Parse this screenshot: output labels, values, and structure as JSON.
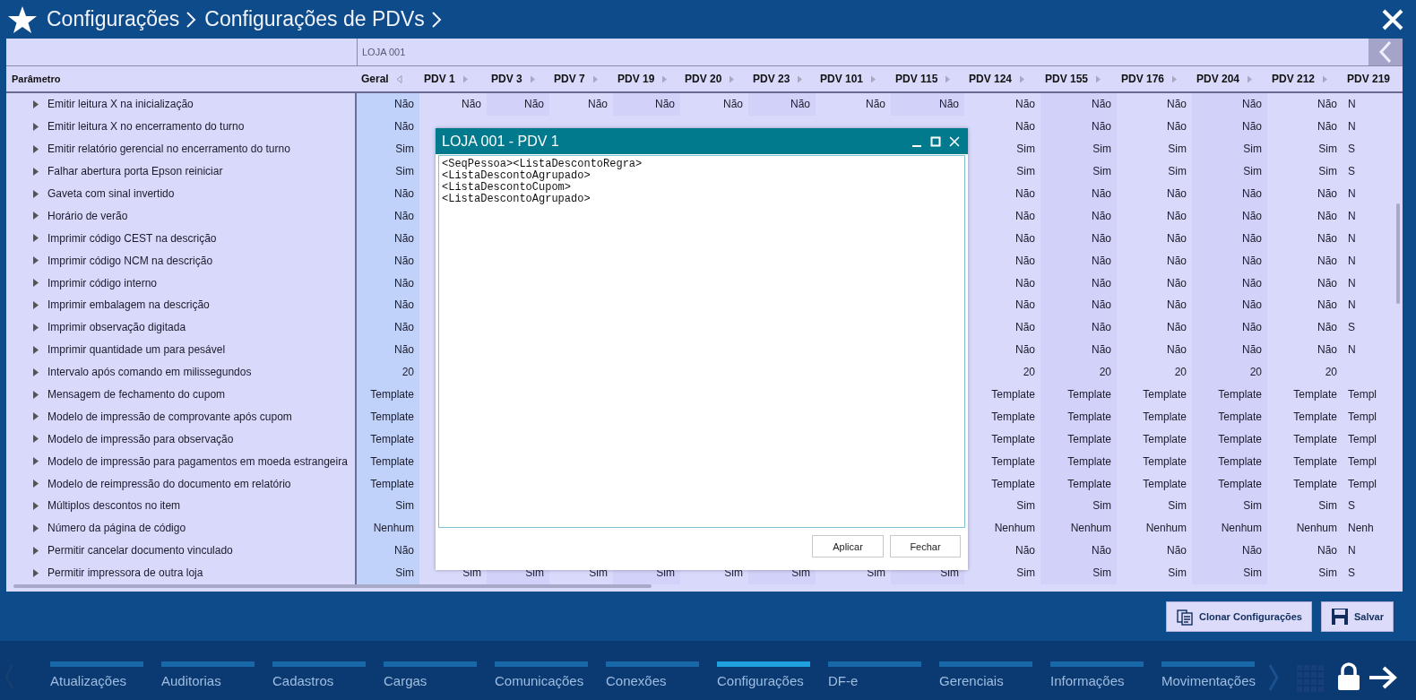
{
  "header": {
    "breadcrumbs": [
      "Configurações",
      "Configurações de PDVs"
    ]
  },
  "table": {
    "group_header": "LOJA 001",
    "parameter_header": "Parâmetro",
    "columns": [
      {
        "label": "Geral",
        "kind": "general"
      },
      {
        "label": "PDV 1",
        "kind": "pdv"
      },
      {
        "label": "PDV 3",
        "kind": "pdv"
      },
      {
        "label": "PDV 7",
        "kind": "pdv"
      },
      {
        "label": "PDV 19",
        "kind": "pdv"
      },
      {
        "label": "PDV 20",
        "kind": "pdv"
      },
      {
        "label": "PDV 23",
        "kind": "pdv"
      },
      {
        "label": "PDV 101",
        "kind": "pdv"
      },
      {
        "label": "PDV 115",
        "kind": "pdv"
      },
      {
        "label": "PDV 124",
        "kind": "pdv"
      },
      {
        "label": "PDV 155",
        "kind": "pdv"
      },
      {
        "label": "PDV 176",
        "kind": "pdv"
      },
      {
        "label": "PDV 204",
        "kind": "pdv"
      },
      {
        "label": "PDV 212",
        "kind": "pdv"
      },
      {
        "label": "PDV 219",
        "kind": "pdv"
      }
    ],
    "rows": [
      {
        "parameter": "Emitir leitura X na inicialização",
        "cells": [
          "Não",
          "Não",
          "Não",
          "Não",
          "Não",
          "Não",
          "Não",
          "Não",
          "Não",
          "Não",
          "Não",
          "Não",
          "Não",
          "Não",
          "N"
        ]
      },
      {
        "parameter": "Emitir leitura X no encerramento do turno",
        "cells": [
          "Não",
          null,
          null,
          null,
          null,
          null,
          null,
          null,
          null,
          "Não",
          "Não",
          "Não",
          "Não",
          "Não",
          "N"
        ]
      },
      {
        "parameter": "Emitir relatório gerencial no encerramento do turno",
        "cells": [
          "Sim",
          null,
          null,
          null,
          null,
          null,
          null,
          null,
          null,
          "Sim",
          "Sim",
          "Sim",
          "Sim",
          "Sim",
          "S"
        ]
      },
      {
        "parameter": "Falhar abertura porta Epson reiniciar",
        "cells": [
          "Sim",
          null,
          null,
          null,
          null,
          null,
          null,
          null,
          null,
          "Sim",
          "Sim",
          "Sim",
          "Sim",
          "Sim",
          "S"
        ]
      },
      {
        "parameter": "Gaveta com sinal invertido",
        "cells": [
          "Não",
          null,
          null,
          null,
          null,
          null,
          null,
          null,
          null,
          "Não",
          "Não",
          "Não",
          "Não",
          "Não",
          "N"
        ]
      },
      {
        "parameter": "Horário de verão",
        "cells": [
          "Não",
          null,
          null,
          null,
          null,
          null,
          null,
          null,
          null,
          "Não",
          "Não",
          "Não",
          "Não",
          "Não",
          "N"
        ]
      },
      {
        "parameter": "Imprimir código CEST na descrição",
        "cells": [
          "Não",
          null,
          null,
          null,
          null,
          null,
          null,
          null,
          null,
          "Não",
          "Não",
          "Não",
          "Não",
          "Não",
          "N"
        ]
      },
      {
        "parameter": "Imprimir código NCM na descrição",
        "cells": [
          "Não",
          null,
          null,
          null,
          null,
          null,
          null,
          null,
          null,
          "Não",
          "Não",
          "Não",
          "Não",
          "Não",
          "N"
        ]
      },
      {
        "parameter": "Imprimir código interno",
        "cells": [
          "Não",
          null,
          null,
          null,
          null,
          null,
          null,
          null,
          null,
          "Não",
          "Não",
          "Não",
          "Não",
          "Não",
          "N"
        ]
      },
      {
        "parameter": "Imprimir embalagem na descrição",
        "cells": [
          "Não",
          null,
          null,
          null,
          null,
          null,
          null,
          null,
          null,
          "Não",
          "Não",
          "Não",
          "Não",
          "Não",
          "N"
        ]
      },
      {
        "parameter": "Imprimir observação digitada",
        "cells": [
          "Não",
          null,
          null,
          null,
          null,
          null,
          null,
          null,
          null,
          "Não",
          "Não",
          "Não",
          "Não",
          "Não",
          "S"
        ]
      },
      {
        "parameter": "Imprimir quantidade um para pesável",
        "cells": [
          "Não",
          null,
          null,
          null,
          null,
          null,
          null,
          null,
          null,
          "Não",
          "Não",
          "Não",
          "Não",
          "Não",
          "N"
        ]
      },
      {
        "parameter": "Intervalo após comando em milissegundos",
        "cells": [
          "20",
          null,
          null,
          null,
          null,
          null,
          null,
          null,
          null,
          "20",
          "20",
          "20",
          "20",
          "20",
          null
        ]
      },
      {
        "parameter": "Mensagem de fechamento do cupom",
        "cells": [
          "Template",
          null,
          null,
          null,
          null,
          null,
          null,
          null,
          null,
          "Template",
          "Template",
          "Template",
          "Template",
          "Template",
          "Templ"
        ]
      },
      {
        "parameter": "Modelo de impressão de comprovante após cupom",
        "cells": [
          "Template",
          null,
          null,
          null,
          null,
          null,
          null,
          null,
          null,
          "Template",
          "Template",
          "Template",
          "Template",
          "Template",
          "Templ"
        ]
      },
      {
        "parameter": "Modelo de impressão para observação",
        "cells": [
          "Template",
          null,
          null,
          null,
          null,
          null,
          null,
          null,
          null,
          "Template",
          "Template",
          "Template",
          "Template",
          "Template",
          "Templ"
        ]
      },
      {
        "parameter": "Modelo de impressão para pagamentos em moeda estrangeira",
        "cells": [
          "Template",
          null,
          null,
          null,
          null,
          null,
          null,
          null,
          null,
          "Template",
          "Template",
          "Template",
          "Template",
          "Template",
          "Templ"
        ]
      },
      {
        "parameter": "Modelo de reimpressão do documento em relatório",
        "cells": [
          "Template",
          null,
          null,
          null,
          null,
          null,
          null,
          null,
          null,
          "Template",
          "Template",
          "Template",
          "Template",
          "Template",
          "Templ"
        ]
      },
      {
        "parameter": "Múltiplos descontos no item",
        "cells": [
          "Sim",
          null,
          null,
          null,
          null,
          null,
          null,
          null,
          null,
          "Sim",
          "Sim",
          "Sim",
          "Sim",
          "Sim",
          "S"
        ]
      },
      {
        "parameter": "Número da página de código",
        "cells": [
          "Nenhum",
          null,
          null,
          null,
          null,
          null,
          null,
          null,
          null,
          "Nenhum",
          "Nenhum",
          "Nenhum",
          "Nenhum",
          "Nenhum",
          "Nenh"
        ]
      },
      {
        "parameter": "Permitir cancelar documento vinculado",
        "cells": [
          "Não",
          null,
          null,
          null,
          null,
          null,
          null,
          null,
          null,
          "Não",
          "Não",
          "Não",
          "Não",
          "Não",
          "N"
        ]
      },
      {
        "parameter": "Permitir impressora de outra loja",
        "cells": [
          "Sim",
          "Sim",
          "Sim",
          "Sim",
          "Sim",
          "Sim",
          "Sim",
          "Sim",
          "Sim",
          "Sim",
          "Sim",
          "Sim",
          "Sim",
          "Sim",
          "S"
        ]
      }
    ]
  },
  "dialog": {
    "title": "LOJA 001 - PDV 1",
    "text": "<SeqPessoa><ListaDescontoRegra>\n<ListaDescontoAgrupado>\n<ListaDescontoCupom>\n<ListaDescontoAgrupado>\n",
    "buttons": [
      "Aplicar",
      "Fechar"
    ]
  },
  "actions": [
    {
      "label": "Clonar Configurações",
      "kind": "clone"
    },
    {
      "label": "Salvar",
      "kind": "save"
    }
  ],
  "nav_tabs": [
    {
      "label": "Atualizações",
      "selected": false
    },
    {
      "label": "Auditorias",
      "selected": false
    },
    {
      "label": "Cadastros",
      "selected": false
    },
    {
      "label": "Cargas",
      "selected": false
    },
    {
      "label": "Comunicações",
      "selected": false
    },
    {
      "label": "Conexões",
      "selected": false
    },
    {
      "label": "Configurações",
      "selected": true
    },
    {
      "label": "DF-e",
      "selected": false
    },
    {
      "label": "Gerenciais",
      "selected": false
    },
    {
      "label": "Informações",
      "selected": false
    },
    {
      "label": "Movimentações",
      "selected": false
    }
  ]
}
